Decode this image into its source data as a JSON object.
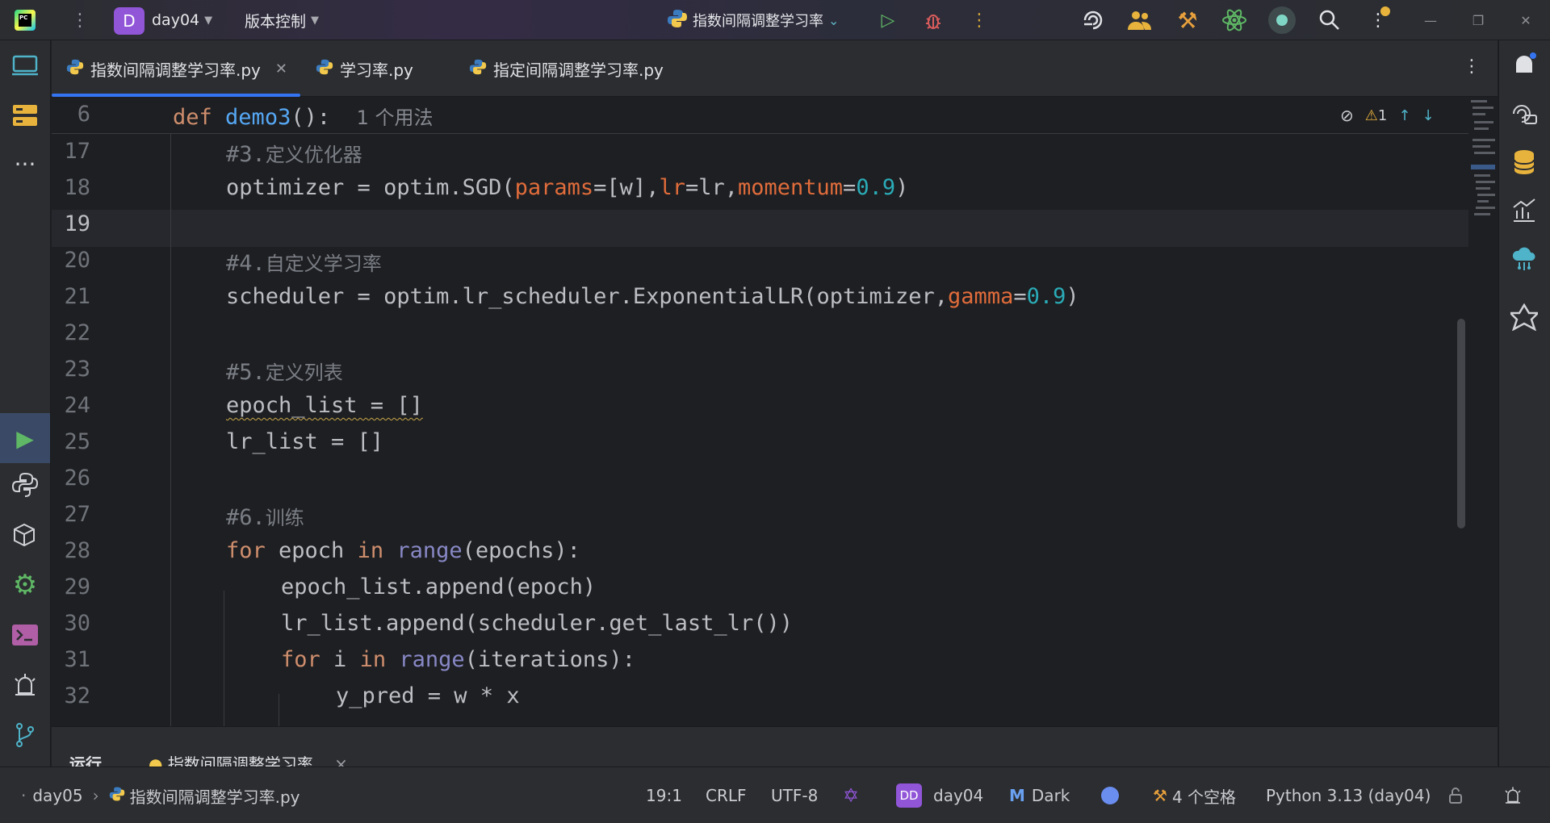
{
  "titlebar": {
    "logo_text": "PC",
    "menu_icon": "⋮",
    "project_badge": "D",
    "project_name": "day04",
    "vcs_label": "版本控制",
    "run_config": "指数间隔调整学习率",
    "icons": [
      "run-icon",
      "debug-icon",
      "more-icon",
      "ai-assistant-icon",
      "code-with-me-icon",
      "build-tools-icon",
      "atom-icon",
      "record-icon",
      "search-icon",
      "settings-icon"
    ]
  },
  "tabs": [
    {
      "label": "指数间隔调整学习率.py",
      "active": true
    },
    {
      "label": "学习率.py",
      "active": false
    },
    {
      "label": "指定间隔调整学习率.py",
      "active": false
    }
  ],
  "editor": {
    "sticky": {
      "line": "6",
      "def": "def",
      "name": "demo3",
      "rest": "():",
      "hint": "1 个用法"
    },
    "toolbar": {
      "warnings": "1"
    },
    "lines": [
      {
        "n": "17",
        "comment_prefix": "#3.",
        "comment_text": "定义优化器"
      },
      {
        "n": "18"
      },
      {
        "n": "19"
      },
      {
        "n": "20",
        "comment_prefix": "#4.",
        "comment_text": "自定义学习率"
      },
      {
        "n": "21"
      },
      {
        "n": "22"
      },
      {
        "n": "23",
        "comment_prefix": "#5.",
        "comment_text": "定义列表"
      },
      {
        "n": "24"
      },
      {
        "n": "25"
      },
      {
        "n": "26"
      },
      {
        "n": "27",
        "comment_prefix": "#6.",
        "comment_text": "训练"
      },
      {
        "n": "28"
      },
      {
        "n": "29"
      },
      {
        "n": "30"
      },
      {
        "n": "31"
      },
      {
        "n": "32"
      }
    ],
    "code": {
      "l18": {
        "a": "optimizer = optim.SGD(",
        "p1": "params",
        "b": "=[w],",
        "p2": "lr",
        "c": "=lr,",
        "p3": "momentum",
        "d": "=",
        "v": "0.9",
        "e": ")"
      },
      "l21": {
        "a": "scheduler = optim.lr_scheduler.ExponentialLR(optimizer,",
        "p": "gamma",
        "b": "=",
        "v": "0.9",
        "c": ")"
      },
      "l24": {
        "a": "epoch_list = []"
      },
      "l25": {
        "a": "lr_list = []"
      },
      "l28": {
        "kw1": "for",
        "a": " epoch ",
        "kw2": "in",
        "sp": " ",
        "bi": "range",
        "b": "(epochs):"
      },
      "l29": {
        "a": "epoch_list.append(epoch)"
      },
      "l30": {
        "a": "lr_list.append(scheduler.get_last_lr())"
      },
      "l31": {
        "kw1": "for",
        "a": " i ",
        "kw2": "in",
        "sp": " ",
        "bi": "range",
        "b": "(iterations):"
      },
      "l32": {
        "a": "y_pred = w * x"
      }
    }
  },
  "bottom_panel": {
    "tab1": "运行",
    "tab2": "指数间隔调整学习率",
    "close": "×"
  },
  "statusbar": {
    "breadcrumb_project": "day05",
    "breadcrumb_file": "指数间隔调整学习率.py",
    "position": "19:1",
    "line_sep": "CRLF",
    "encoding": "UTF-8",
    "profile_badge": "DD",
    "profile_name": "day04",
    "theme": "Dark",
    "indent": "4 个空格",
    "interpreter": "Python 3.13 (day04)"
  },
  "colors": {
    "accent": "#3574f0",
    "project": "#9155d8",
    "keyword": "#cf8e6d",
    "function": "#56a8f5",
    "number": "#2aacb8"
  }
}
